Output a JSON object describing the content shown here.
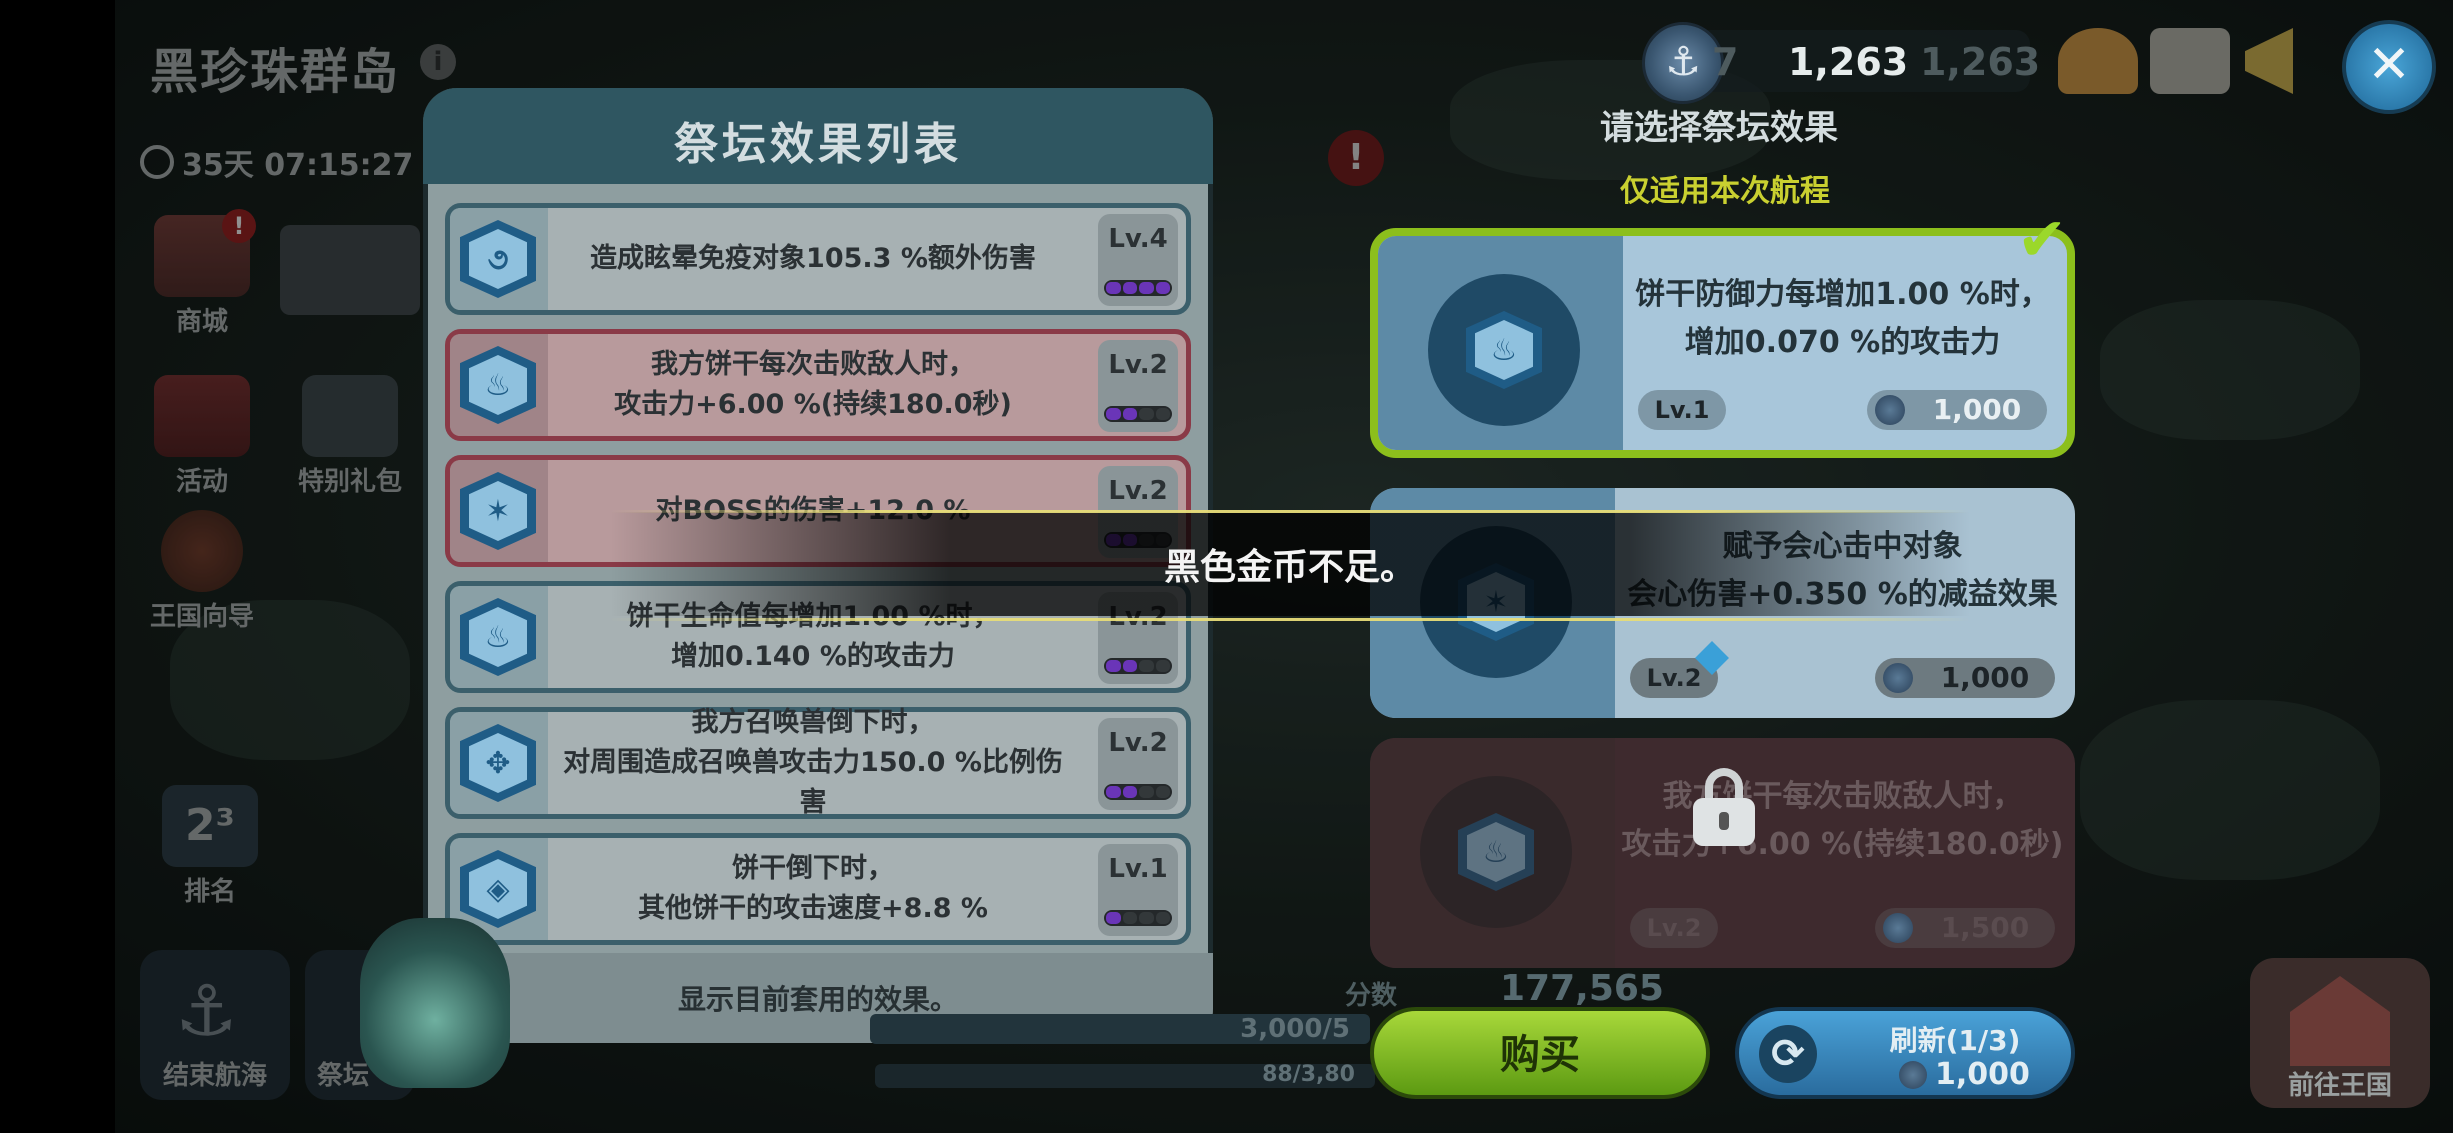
{
  "region": {
    "title": "黑珍珠群岛",
    "info_icon": "info-icon"
  },
  "timer": {
    "text": "35天 07:15:27"
  },
  "side_menu": [
    {
      "label": "商城",
      "badge": "!"
    },
    {
      "label": "活动"
    },
    {
      "label": "特别礼包"
    },
    {
      "label": "王国向导"
    },
    {
      "label": "排名"
    }
  ],
  "bottom_menu": {
    "end_voyage": "结束航海",
    "altar": "祭坛",
    "goto_kingdom": "前往王国"
  },
  "currency": {
    "faint_prefix": "7",
    "black_coin": "1,263",
    "black_coin_2": "1,263"
  },
  "close": {
    "glyph": "✕"
  },
  "list_panel": {
    "title": "祭坛效果列表",
    "footer": "显示目前套用的效果。",
    "rows": [
      {
        "line1": "造成眩晕免疫对象105.3 %额外伤害",
        "line2": "",
        "level": "Lv.4",
        "filled": 4,
        "icon_glyph": "૭",
        "style": "blue"
      },
      {
        "line1": "我方饼干每次击败敌人时，",
        "line2": "攻击力+6.00 %(持续180.0秒)",
        "level": "Lv.2",
        "filled": 2,
        "icon_glyph": "♨",
        "style": "red"
      },
      {
        "line1": "对BOSS的伤害+12.0 %",
        "line2": "",
        "level": "Lv.2",
        "filled": 2,
        "icon_glyph": "✶",
        "style": "red"
      },
      {
        "line1": "饼干生命值每增加1.00 %时，",
        "line2": "增加0.140 %的攻击力",
        "level": "Lv.2",
        "filled": 2,
        "icon_glyph": "♨",
        "style": "blue"
      },
      {
        "line1": "我方召唤兽倒下时，",
        "line2": "对周围造成召唤兽攻击力150.0 %比例伤害",
        "level": "Lv.2",
        "filled": 2,
        "icon_glyph": "✥",
        "style": "blue"
      },
      {
        "line1": "饼干倒下时，",
        "line2": "其他饼干的攻击速度+8.8 %",
        "level": "Lv.1",
        "filled": 1,
        "icon_glyph": "◈",
        "style": "blue"
      }
    ]
  },
  "select": {
    "title": "请选择祭坛效果",
    "subtitle": "仅适用本次航程"
  },
  "cards": [
    {
      "line1": "饼干防御力每增加1.00 %时，",
      "line2": "增加0.070 %的攻击力",
      "level": "Lv.1",
      "cost": "1,000",
      "selected": true,
      "locked": false
    },
    {
      "line1": "赋予会心击中对象",
      "line2": "会心伤害+0.350 %的减益效果",
      "level": "Lv.2",
      "cost": "1,000",
      "selected": false,
      "locked": false
    },
    {
      "line1": "我方饼干每次击败敌人时，",
      "line2": "攻击力+6.00 %(持续180.0秒)",
      "level": "Lv.2",
      "cost": "1,500",
      "selected": false,
      "locked": true
    }
  ],
  "buttons": {
    "buy": "购买",
    "refresh_title": "刷新(1/3)",
    "refresh_cost": "1,000"
  },
  "stats": {
    "score_label": "分数",
    "score": "177,565",
    "progress1": "3,000/5",
    "progress2": "88/3,80"
  },
  "toast": {
    "message": "黑色金币不足。"
  },
  "colors": {
    "selected_border": "#8cbf1c",
    "toast_line": "#e6dc78",
    "subtitle": "#c9d030"
  }
}
